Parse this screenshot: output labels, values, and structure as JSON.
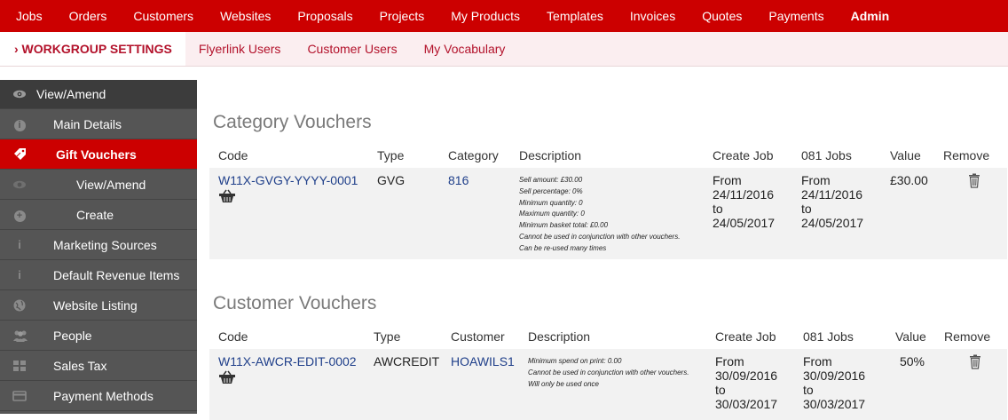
{
  "topnav": [
    {
      "label": "Jobs"
    },
    {
      "label": "Orders"
    },
    {
      "label": "Customers"
    },
    {
      "label": "Websites"
    },
    {
      "label": "Proposals"
    },
    {
      "label": "Projects"
    },
    {
      "label": "My Products"
    },
    {
      "label": "Templates"
    },
    {
      "label": "Invoices"
    },
    {
      "label": "Quotes"
    },
    {
      "label": "Payments"
    },
    {
      "label": "Admin",
      "active": true
    }
  ],
  "subnav": [
    {
      "label": "› WORKGROUP SETTINGS",
      "active": true
    },
    {
      "label": "Flyerlink Users"
    },
    {
      "label": "Customer Users"
    },
    {
      "label": "My Vocabulary"
    }
  ],
  "sidebar": {
    "items": [
      {
        "label": "View/Amend",
        "icon": "eye-icon"
      },
      {
        "label": "Main Details",
        "icon": "info-icon"
      },
      {
        "label": "Gift Vouchers",
        "icon": "tag-icon"
      },
      {
        "label": "View/Amend",
        "icon": "eye-icon"
      },
      {
        "label": "Create",
        "icon": "plus-circle-icon"
      },
      {
        "label": "Marketing Sources",
        "icon": "info-small-icon"
      },
      {
        "label": "Default Revenue Items",
        "icon": "info-small-icon"
      },
      {
        "label": "Website Listing",
        "icon": "globe-icon"
      },
      {
        "label": "People",
        "icon": "users-icon"
      },
      {
        "label": "Sales Tax",
        "icon": "grid-icon"
      },
      {
        "label": "Payment Methods",
        "icon": "credit-card-icon"
      }
    ]
  },
  "category": {
    "title": "Category Vouchers",
    "headers": [
      "Code",
      "Type",
      "Category",
      "Description",
      "Create Job",
      "081 Jobs",
      "Value",
      "Remove"
    ],
    "rows": [
      {
        "code": "W11X-GVGY-YYYY-0001",
        "type": "GVG",
        "category": "816",
        "description": [
          "Sell amount: £30.00",
          "Sell percentage: 0%",
          "Minimum quantity: 0",
          "Maximum quantity: 0",
          "Minimum basket total: £0.00",
          "Cannot be used in conjunction with other vouchers.",
          "Can be re-used many times"
        ],
        "create_job": [
          "From",
          "24/11/2016",
          "to",
          "24/05/2017"
        ],
        "jobs081": [
          "From",
          "24/11/2016",
          "to",
          "24/05/2017"
        ],
        "value": "£30.00"
      }
    ]
  },
  "customer": {
    "title": "Customer Vouchers",
    "headers": [
      "Code",
      "Type",
      "Customer",
      "Description",
      "Create Job",
      "081 Jobs",
      "Value",
      "Remove"
    ],
    "rows": [
      {
        "code": "W11X-AWCR-EDIT-0002",
        "type": "AWCREDIT",
        "customer": "HOAWILS1",
        "description": [
          "Minimum spend on print: 0.00",
          "Cannot be used in conjunction with other vouchers.",
          "Will only be used once"
        ],
        "create_job": [
          "From",
          "30/09/2016",
          "to",
          "30/03/2017"
        ],
        "jobs081": [
          "From",
          "30/09/2016",
          "to",
          "30/03/2017"
        ],
        "value": "50%"
      }
    ]
  },
  "colors": {
    "brand": "#cc0000",
    "link": "#1f3f8a",
    "sidebar": "#555555",
    "subnav_bg": "#fbeef0"
  }
}
